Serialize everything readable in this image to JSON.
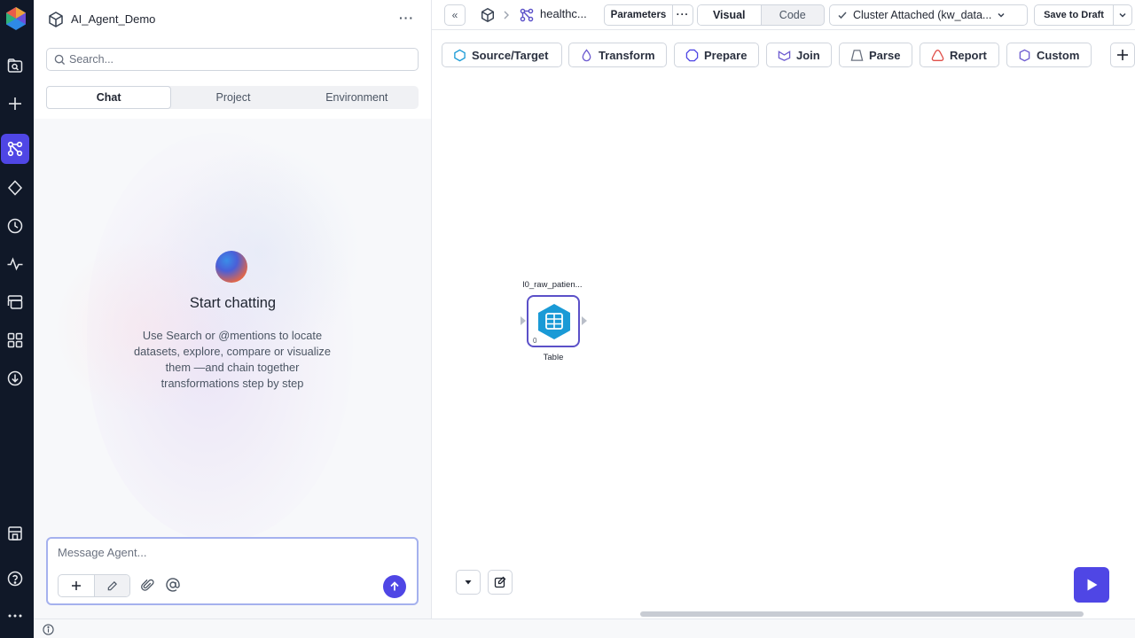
{
  "colors": {
    "accent": "#4f46e5",
    "rail_bg": "#101828",
    "node_border": "#5b50c8",
    "table_icon": "#1a9ad6",
    "transform_icon": "#6d5bd0",
    "report_icon": "#e0504a"
  },
  "rail": {
    "icons": [
      "logo-icon",
      "dataset-search-icon",
      "plus-icon",
      "pipeline-icon",
      "gem-icon",
      "history-icon",
      "activity-icon",
      "deployments-icon",
      "apps-grid-icon",
      "download-icon",
      "marketplace-icon",
      "help-icon",
      "more-icon"
    ]
  },
  "agent_panel": {
    "project_name": "AI_Agent_Demo",
    "more_label": "···",
    "search": {
      "placeholder": "Search..."
    },
    "tabs": [
      {
        "label": "Chat",
        "active": true
      },
      {
        "label": "Project",
        "active": false
      },
      {
        "label": "Environment",
        "active": false
      }
    ],
    "empty_state": {
      "title": "Start chatting",
      "description": "Use Search or @mentions to locate datasets, explore, compare or visualize them —and chain together transformations step by step"
    },
    "message": {
      "placeholder": "Message Agent..."
    }
  },
  "topbar": {
    "collapse_label": "«",
    "pipeline_name": "healthc...",
    "parameters_label": "Parameters",
    "parameters_more_label": "···",
    "views": [
      {
        "label": "Visual",
        "active": true
      },
      {
        "label": "Code",
        "active": false
      }
    ],
    "cluster_label": "Cluster Attached (kw_data...",
    "save_label": "Save to Draft"
  },
  "gem_toolbar": {
    "items": [
      {
        "label": "Source/Target",
        "icon": "source-target-icon"
      },
      {
        "label": "Transform",
        "icon": "transform-icon"
      },
      {
        "label": "Prepare",
        "icon": "prepare-icon"
      },
      {
        "label": "Join",
        "icon": "join-icon"
      },
      {
        "label": "Parse",
        "icon": "parse-icon"
      },
      {
        "label": "Report",
        "icon": "report-icon"
      },
      {
        "label": "Custom",
        "icon": "custom-icon"
      }
    ]
  },
  "canvas": {
    "node": {
      "title": "l0_raw_patien...",
      "type": "Table",
      "count": "0",
      "icon": "table-icon"
    }
  }
}
